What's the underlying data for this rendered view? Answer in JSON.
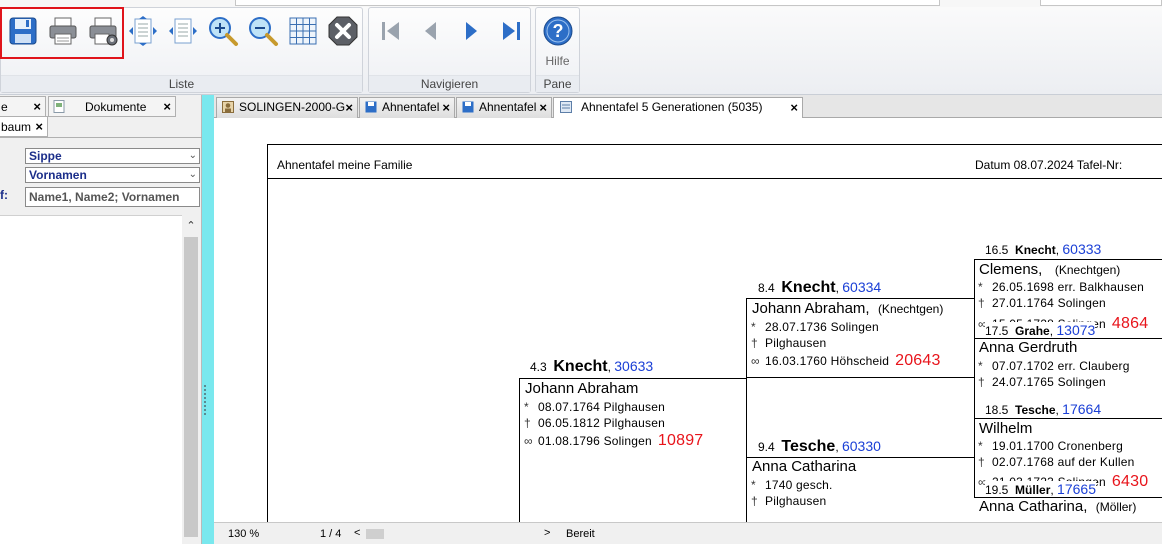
{
  "ribbon": {
    "groups": [
      {
        "label": "Liste"
      },
      {
        "label": "Navigieren"
      },
      {
        "label": "Pane"
      }
    ],
    "help_label": "Hilfe",
    "buttons": [
      "save-icon",
      "print-icon",
      "print-settings-icon",
      "page-width-icon",
      "page-height-icon",
      "zoom-in-icon",
      "zoom-out-icon",
      "grid-icon",
      "close-icon",
      "first-icon",
      "previous-icon",
      "next-icon",
      "last-icon",
      "help-icon"
    ]
  },
  "left_panel": {
    "tabs": [
      {
        "label": "e"
      },
      {
        "label": "Dokumente"
      },
      {
        "label": "baum"
      }
    ],
    "combo1": "Sippe",
    "combo2": "Vornamen",
    "field_label": "f:",
    "textbox": "Name1, Name2; Vornamen"
  },
  "doc_tabs": [
    {
      "label": "SOLINGEN-2000-G"
    },
    {
      "label": "Ahnentafel"
    },
    {
      "label": "Ahnentafel"
    },
    {
      "label": "Ahnentafel 5 Generationen (5035)"
    }
  ],
  "report": {
    "header_left": "Ahnentafel  meine  Familie",
    "header_right": "Datum   08.07.2024   Tafel-Nr:",
    "persons": {
      "p4_3": {
        "gen": "4.3",
        "surname": "Knecht",
        "num": "30633",
        "given": "Johann  Abraham",
        "extra": "",
        "birth": "08.07.1764  Pilghausen",
        "death": "06.05.1812  Pilghausen",
        "marriage": "01.08.1796  Solingen",
        "ref": "10897"
      },
      "p8_4": {
        "gen": "8.4",
        "surname": "Knecht",
        "num": "60334",
        "given": "Johann  Abraham,",
        "extra": "(Knechtgen)",
        "birth": "28.07.1736  Solingen",
        "death": "Pilghausen",
        "marriage": "16.03.1760  Höhscheid",
        "ref": "20643"
      },
      "p9_4": {
        "gen": "9.4",
        "surname": "Tesche",
        "num": "60330",
        "given": "Anna  Catharina",
        "birth": "1740  gesch.",
        "death": "Pilghausen"
      },
      "p16_5": {
        "gen": "16.5",
        "surname": "Knecht",
        "num": "60333",
        "given": "Clemens,",
        "extra": "(Knechtgen)",
        "birth": "26.05.1698  err.  Balkhausen",
        "death": "27.01.1764  Solingen",
        "marriage": "15.05.1728  Solingen",
        "ref": "4864"
      },
      "p17_5": {
        "gen": "17.5",
        "surname": "Grahe",
        "num": "13073",
        "given": "Anna  Gerdruth",
        "birth": "07.07.1702  err.  Clauberg",
        "death": "24.07.1765  Solingen"
      },
      "p18_5": {
        "gen": "18.5",
        "surname": "Tesche",
        "num": "17664",
        "given": "Wilhelm",
        "birth": "19.01.1700  Cronenberg",
        "death": "02.07.1768  auf  der  Kullen",
        "marriage": "21.03.1723  Solingen",
        "ref": "6430"
      },
      "p19_5": {
        "gen": "19.5",
        "surname": "Müller",
        "num": "17665",
        "given": "Anna  Catharina,",
        "extra": "(Möller)"
      }
    }
  },
  "status": {
    "zoom": "130 %",
    "page": "1 / 4",
    "state": "Bereit"
  },
  "colors": {
    "accent_highlight": "#e0141b",
    "link_blue": "#1a3fd6",
    "ref_red": "#e8141b",
    "splitter_cyan": "#79e8ee"
  }
}
